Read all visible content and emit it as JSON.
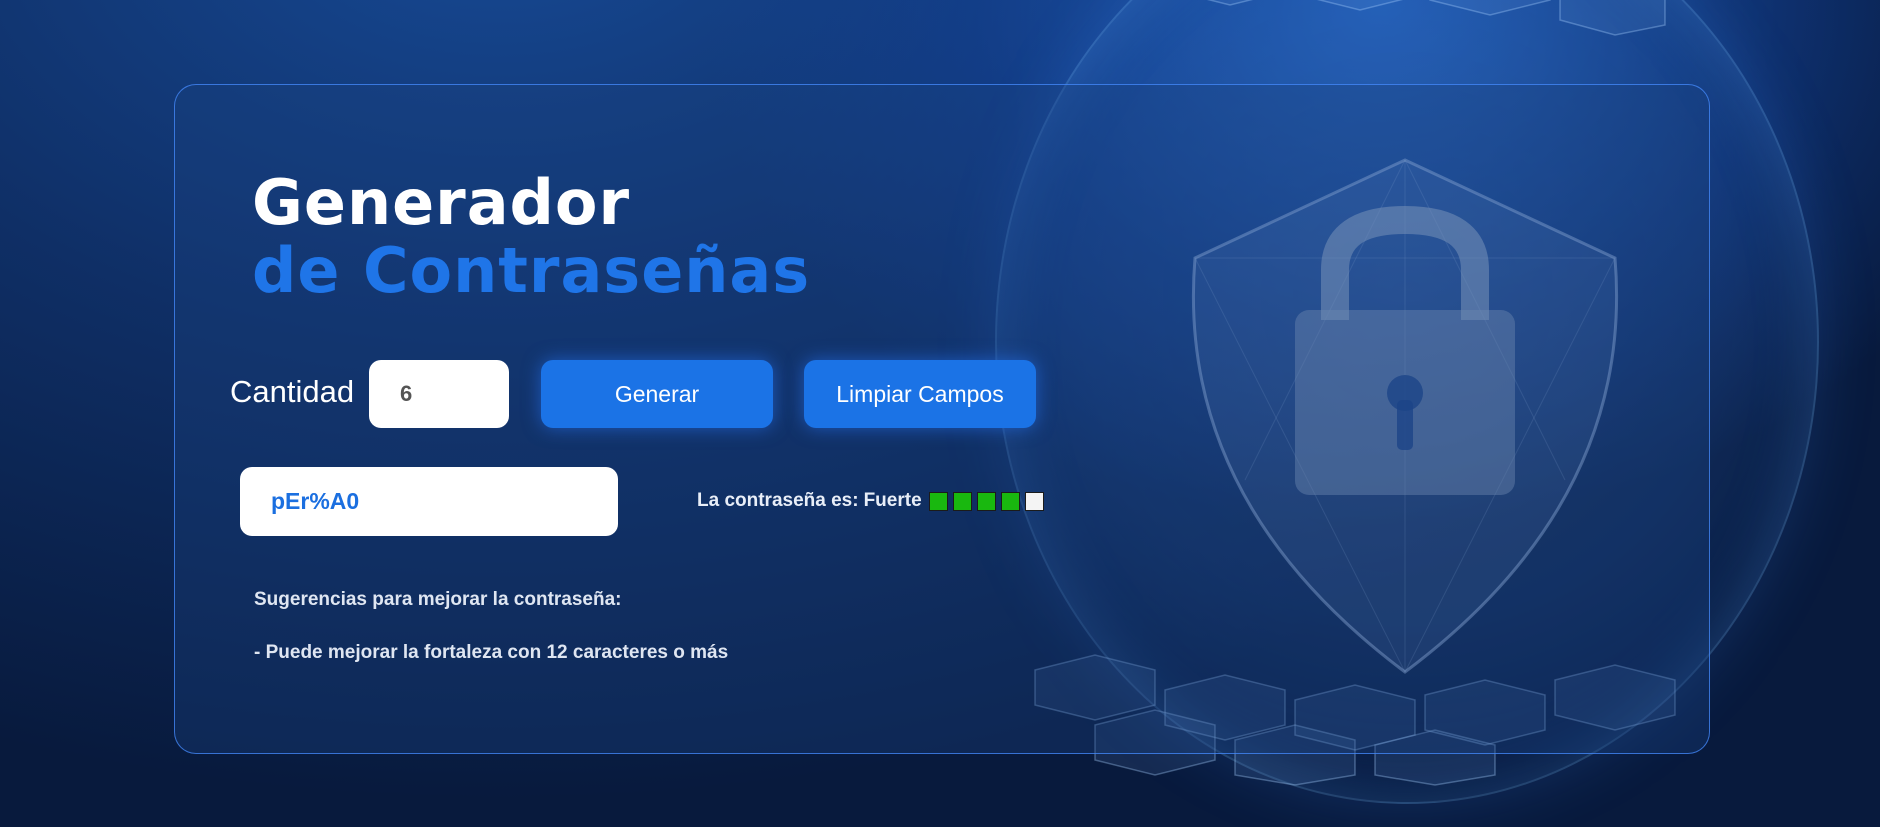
{
  "header": {
    "title_line1": "Generador",
    "title_line2": "de Contraseñas"
  },
  "controls": {
    "quantity_label": "Cantidad",
    "quantity_value": "6",
    "generate_label": "Generar",
    "clear_label": "Limpiar Campos"
  },
  "result": {
    "password": "pEr%A0",
    "strength_prefix": "La contraseña es:",
    "strength_value": "Fuerte",
    "strength_level": 4,
    "strength_max": 5,
    "strength_on_color": "#19b80f",
    "strength_off_color": "#f4f4f4"
  },
  "suggestions": {
    "title": "Sugerencias para mejorar la contraseña:",
    "items": [
      "- Puede mejorar la fortaleza con 12 caracteres o más"
    ]
  },
  "colors": {
    "accent": "#1b73e6",
    "title_accent": "#1f75e8",
    "background": "#0f2f66"
  },
  "decoration": {
    "background_art": "shield-lock-globe-icon"
  }
}
